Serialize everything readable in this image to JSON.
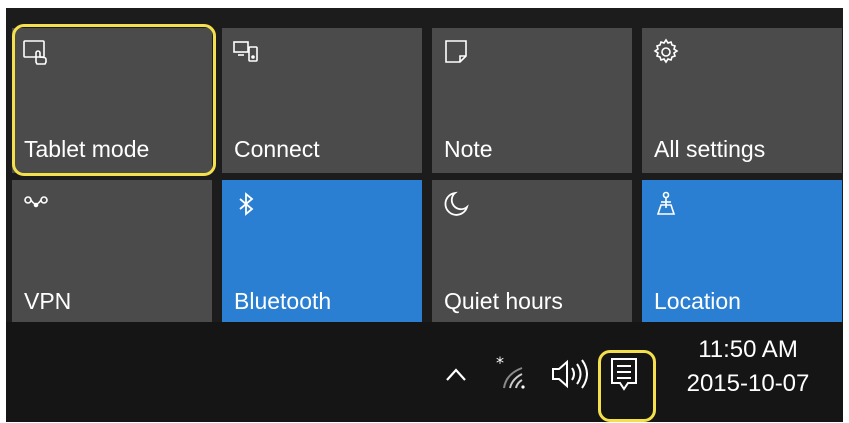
{
  "quick_actions": [
    {
      "label": "Tablet mode",
      "icon": "tablet-mode-icon",
      "active": false
    },
    {
      "label": "Connect",
      "icon": "connect-icon",
      "active": false
    },
    {
      "label": "Note",
      "icon": "note-icon",
      "active": false
    },
    {
      "label": "All settings",
      "icon": "gear-icon",
      "active": false
    },
    {
      "label": "VPN",
      "icon": "vpn-icon",
      "active": false
    },
    {
      "label": "Bluetooth",
      "icon": "bluetooth-icon",
      "active": true
    },
    {
      "label": "Quiet hours",
      "icon": "moon-icon",
      "active": false
    },
    {
      "label": "Location",
      "icon": "location-icon",
      "active": true
    }
  ],
  "taskbar": {
    "clock": {
      "time": "11:50 AM",
      "date": "2015-10-07"
    },
    "icons": [
      "chevron-up-icon",
      "wifi-icon",
      "volume-icon",
      "action-center-icon"
    ]
  },
  "colors": {
    "tile": "#4b4b4b",
    "tile_active": "#2a7fd2",
    "panel": "#1c1c1c",
    "taskbar": "#151515",
    "highlight": "#f4e04d"
  }
}
